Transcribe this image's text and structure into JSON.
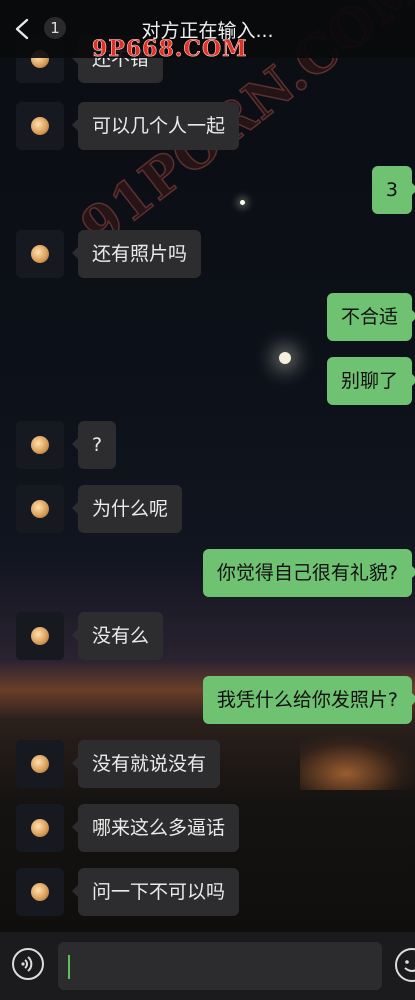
{
  "header": {
    "back_count": "1",
    "title": "对方正在输入...",
    "watermark_top": "9P668.COM",
    "watermark_diagonal": "91PORN.COM"
  },
  "icons": {
    "back": "chevron-left-icon",
    "voice": "voice-icon",
    "emoji": "emoji-icon",
    "avatar": "moon-avatar"
  },
  "messages": [
    {
      "side": "in",
      "text": "还不错"
    },
    {
      "side": "in",
      "text": "可以几个人一起"
    },
    {
      "side": "out",
      "text": "3"
    },
    {
      "side": "in",
      "text": "还有照片吗"
    },
    {
      "side": "out",
      "text": "不合适"
    },
    {
      "side": "out",
      "text": "别聊了"
    },
    {
      "side": "in",
      "text": "?"
    },
    {
      "side": "in",
      "text": "为什么呢"
    },
    {
      "side": "out",
      "text": "你觉得自己很有礼貌?"
    },
    {
      "side": "in",
      "text": "没有么"
    },
    {
      "side": "out",
      "text": "我凭什么给你发照片?"
    },
    {
      "side": "in",
      "text": "没有就说没有"
    },
    {
      "side": "in",
      "text": "哪来这么多逼话"
    },
    {
      "side": "in",
      "text": "问一下不可以吗"
    }
  ],
  "input": {
    "value": ""
  },
  "colors": {
    "outgoing": "#6fc271",
    "incoming": "#2d2d2f",
    "caret": "#5ac15f"
  }
}
